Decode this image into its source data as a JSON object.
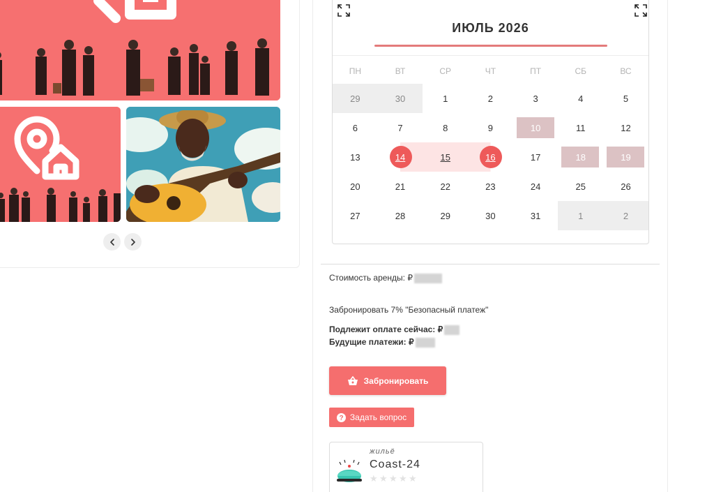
{
  "calendar": {
    "month_title": "ИЮЛЬ 2026",
    "weekdays": [
      "ПН",
      "ВТ",
      "СР",
      "ЧТ",
      "ПТ",
      "СБ",
      "ВС"
    ],
    "weeks": [
      [
        "29",
        "30",
        "1",
        "2",
        "3",
        "4",
        "5"
      ],
      [
        "6",
        "7",
        "8",
        "9",
        "10",
        "11",
        "12"
      ],
      [
        "13",
        "14",
        "15",
        "16",
        "17",
        "18",
        "19"
      ],
      [
        "20",
        "21",
        "22",
        "23",
        "24",
        "25",
        "26"
      ],
      [
        "27",
        "28",
        "29",
        "30",
        "31",
        "1",
        "2"
      ]
    ],
    "selected_range": [
      "14",
      "15",
      "16"
    ]
  },
  "booking": {
    "rent_cost_label": "Стоимость аренды: ₽",
    "reserve_note": "Забронировать 7% \"Безопасный платеж\"",
    "pay_now_label": "Подлежит оплате сейчас: ₽",
    "future_payments_label": "Будущие платежи: ₽",
    "book_button": "Забронировать",
    "ask_button": "Задать вопрос"
  },
  "host": {
    "category": "жильё",
    "name": "Coast-24",
    "rating_stars": 0,
    "rating_max": 5
  },
  "colors": {
    "accent": "#f56e6e",
    "selected_circle": "#ee5a5a",
    "range_fill": "#fde4e4",
    "blocked": "#dcc2c4"
  },
  "icons": {
    "expand": "expand-icon",
    "prev": "chevron-left-icon",
    "next": "chevron-right-icon",
    "basket": "basket-icon",
    "question": "question-icon"
  }
}
